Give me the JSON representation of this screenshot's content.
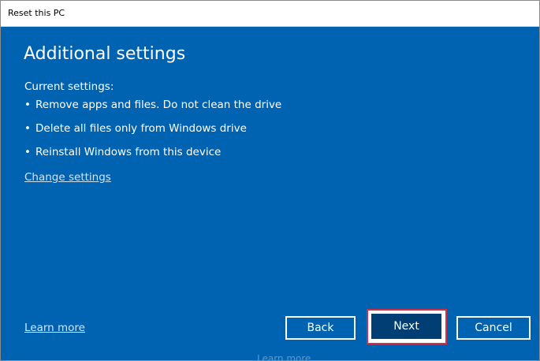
{
  "window": {
    "title": "Reset this PC"
  },
  "main": {
    "heading": "Additional settings",
    "current_label": "Current settings:",
    "bullets": [
      "Remove apps and files. Do not clean the drive",
      "Delete all files only from Windows drive",
      "Reinstall Windows from this device"
    ],
    "change_link": "Change settings",
    "learn_link": "Learn more"
  },
  "buttons": {
    "back": "Back",
    "next": "Next",
    "cancel": "Cancel"
  },
  "ghost_text": "Learn more",
  "colors": {
    "background": "#0063b1",
    "next_button": "#003e74",
    "highlight": "#d0314a"
  }
}
